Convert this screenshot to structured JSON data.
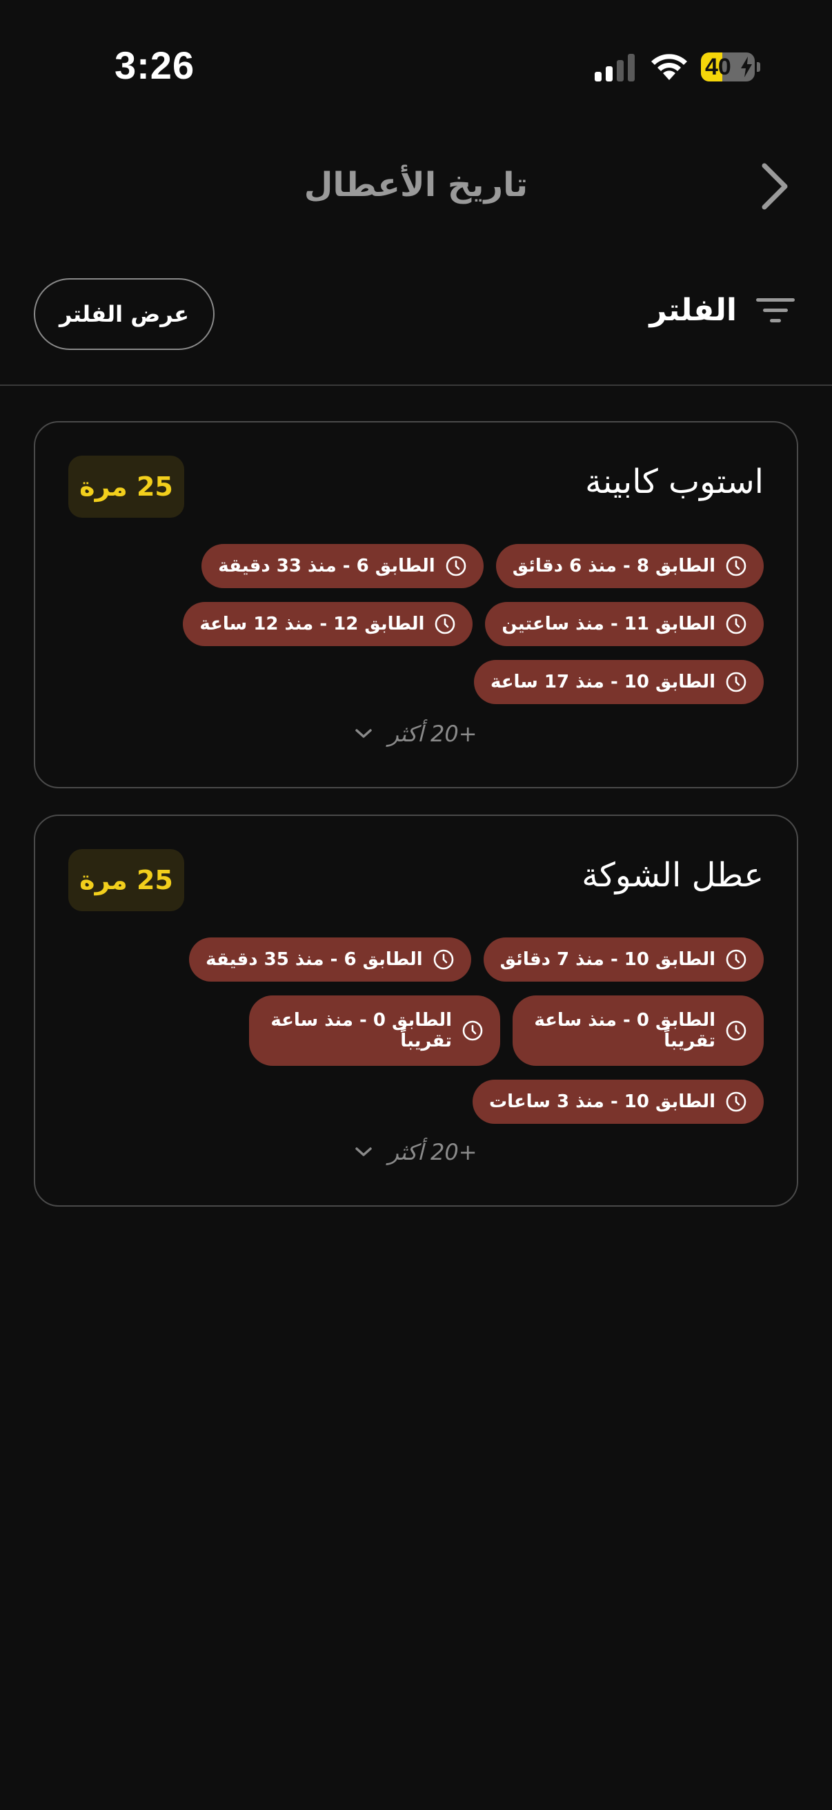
{
  "status_bar": {
    "time": "3:26",
    "battery_level": "40",
    "battery_fraction": 0.4
  },
  "header": {
    "title": "تاريخ الأعطال",
    "back_icon": "chevron-right-icon"
  },
  "filter": {
    "label": "الفلتر",
    "icon": "filter-icon",
    "show_button": "عرض الفلتر"
  },
  "cards": [
    {
      "title": "استوب كابينة",
      "count": "25 مرة",
      "chips": [
        "الطابق 8 - منذ 6 دقائق",
        "الطابق 6 - منذ 33 دقيقة",
        "الطابق 11 - منذ ساعتين",
        "الطابق 12 - منذ 12 ساعة",
        "الطابق 10 - منذ 17 ساعة"
      ],
      "more": "+20 أكثر"
    },
    {
      "title": "عطل الشوكة",
      "count": "25 مرة",
      "chips": [
        "الطابق 10 - منذ 7 دقائق",
        "الطابق 6 - منذ 35 دقيقة",
        "الطابق 0 - منذ ساعة تقريباً",
        "الطابق 0 - منذ ساعة تقريباً",
        "الطابق 10 - منذ 3 ساعات"
      ],
      "more": "+20 أكثر"
    }
  ],
  "colors": {
    "background": "#0e0e0e",
    "chip": "#7a342c",
    "badge_bg": "#2a2510",
    "badge_text": "#f2cf1c",
    "battery": "#f5d60a"
  }
}
